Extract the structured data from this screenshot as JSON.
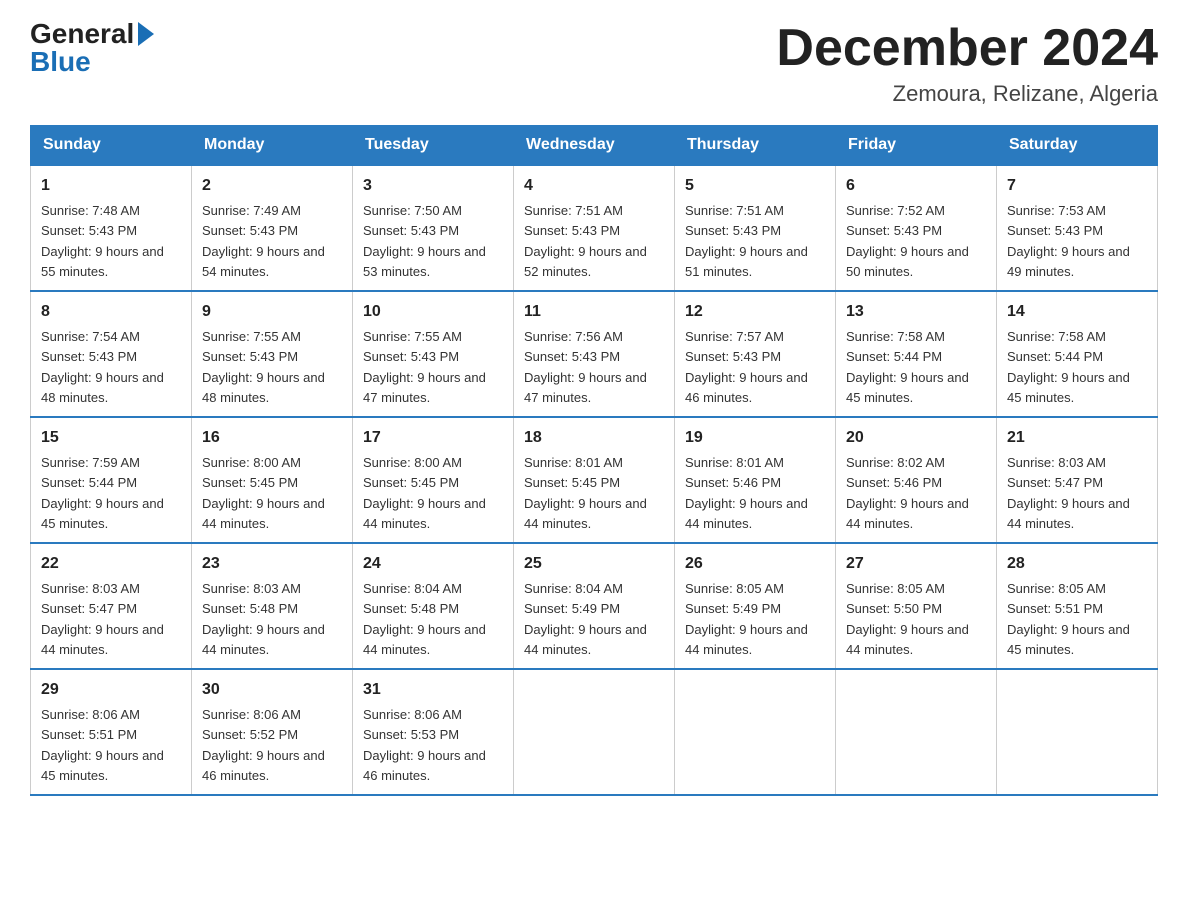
{
  "header": {
    "logo": {
      "general": "General",
      "blue": "Blue"
    },
    "month_title": "December 2024",
    "location": "Zemoura, Relizane, Algeria"
  },
  "days_of_week": [
    "Sunday",
    "Monday",
    "Tuesday",
    "Wednesday",
    "Thursday",
    "Friday",
    "Saturday"
  ],
  "weeks": [
    [
      {
        "day": "1",
        "sunrise": "7:48 AM",
        "sunset": "5:43 PM",
        "daylight": "9 hours and 55 minutes."
      },
      {
        "day": "2",
        "sunrise": "7:49 AM",
        "sunset": "5:43 PM",
        "daylight": "9 hours and 54 minutes."
      },
      {
        "day": "3",
        "sunrise": "7:50 AM",
        "sunset": "5:43 PM",
        "daylight": "9 hours and 53 minutes."
      },
      {
        "day": "4",
        "sunrise": "7:51 AM",
        "sunset": "5:43 PM",
        "daylight": "9 hours and 52 minutes."
      },
      {
        "day": "5",
        "sunrise": "7:51 AM",
        "sunset": "5:43 PM",
        "daylight": "9 hours and 51 minutes."
      },
      {
        "day": "6",
        "sunrise": "7:52 AM",
        "sunset": "5:43 PM",
        "daylight": "9 hours and 50 minutes."
      },
      {
        "day": "7",
        "sunrise": "7:53 AM",
        "sunset": "5:43 PM",
        "daylight": "9 hours and 49 minutes."
      }
    ],
    [
      {
        "day": "8",
        "sunrise": "7:54 AM",
        "sunset": "5:43 PM",
        "daylight": "9 hours and 48 minutes."
      },
      {
        "day": "9",
        "sunrise": "7:55 AM",
        "sunset": "5:43 PM",
        "daylight": "9 hours and 48 minutes."
      },
      {
        "day": "10",
        "sunrise": "7:55 AM",
        "sunset": "5:43 PM",
        "daylight": "9 hours and 47 minutes."
      },
      {
        "day": "11",
        "sunrise": "7:56 AM",
        "sunset": "5:43 PM",
        "daylight": "9 hours and 47 minutes."
      },
      {
        "day": "12",
        "sunrise": "7:57 AM",
        "sunset": "5:43 PM",
        "daylight": "9 hours and 46 minutes."
      },
      {
        "day": "13",
        "sunrise": "7:58 AM",
        "sunset": "5:44 PM",
        "daylight": "9 hours and 45 minutes."
      },
      {
        "day": "14",
        "sunrise": "7:58 AM",
        "sunset": "5:44 PM",
        "daylight": "9 hours and 45 minutes."
      }
    ],
    [
      {
        "day": "15",
        "sunrise": "7:59 AM",
        "sunset": "5:44 PM",
        "daylight": "9 hours and 45 minutes."
      },
      {
        "day": "16",
        "sunrise": "8:00 AM",
        "sunset": "5:45 PM",
        "daylight": "9 hours and 44 minutes."
      },
      {
        "day": "17",
        "sunrise": "8:00 AM",
        "sunset": "5:45 PM",
        "daylight": "9 hours and 44 minutes."
      },
      {
        "day": "18",
        "sunrise": "8:01 AM",
        "sunset": "5:45 PM",
        "daylight": "9 hours and 44 minutes."
      },
      {
        "day": "19",
        "sunrise": "8:01 AM",
        "sunset": "5:46 PM",
        "daylight": "9 hours and 44 minutes."
      },
      {
        "day": "20",
        "sunrise": "8:02 AM",
        "sunset": "5:46 PM",
        "daylight": "9 hours and 44 minutes."
      },
      {
        "day": "21",
        "sunrise": "8:03 AM",
        "sunset": "5:47 PM",
        "daylight": "9 hours and 44 minutes."
      }
    ],
    [
      {
        "day": "22",
        "sunrise": "8:03 AM",
        "sunset": "5:47 PM",
        "daylight": "9 hours and 44 minutes."
      },
      {
        "day": "23",
        "sunrise": "8:03 AM",
        "sunset": "5:48 PM",
        "daylight": "9 hours and 44 minutes."
      },
      {
        "day": "24",
        "sunrise": "8:04 AM",
        "sunset": "5:48 PM",
        "daylight": "9 hours and 44 minutes."
      },
      {
        "day": "25",
        "sunrise": "8:04 AM",
        "sunset": "5:49 PM",
        "daylight": "9 hours and 44 minutes."
      },
      {
        "day": "26",
        "sunrise": "8:05 AM",
        "sunset": "5:49 PM",
        "daylight": "9 hours and 44 minutes."
      },
      {
        "day": "27",
        "sunrise": "8:05 AM",
        "sunset": "5:50 PM",
        "daylight": "9 hours and 44 minutes."
      },
      {
        "day": "28",
        "sunrise": "8:05 AM",
        "sunset": "5:51 PM",
        "daylight": "9 hours and 45 minutes."
      }
    ],
    [
      {
        "day": "29",
        "sunrise": "8:06 AM",
        "sunset": "5:51 PM",
        "daylight": "9 hours and 45 minutes."
      },
      {
        "day": "30",
        "sunrise": "8:06 AM",
        "sunset": "5:52 PM",
        "daylight": "9 hours and 46 minutes."
      },
      {
        "day": "31",
        "sunrise": "8:06 AM",
        "sunset": "5:53 PM",
        "daylight": "9 hours and 46 minutes."
      },
      null,
      null,
      null,
      null
    ]
  ]
}
